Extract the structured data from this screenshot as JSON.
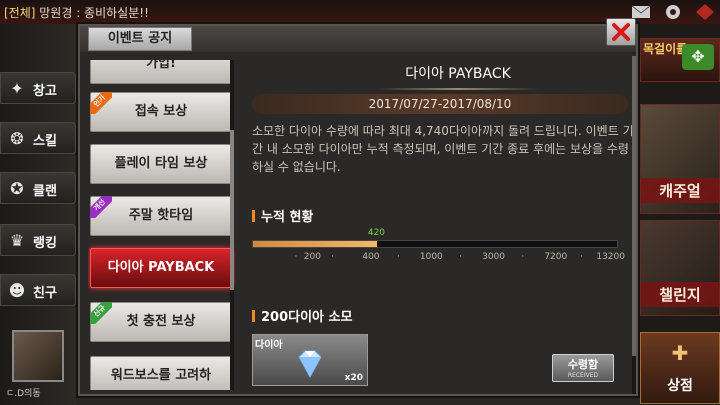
{
  "background": {
    "notice_tag": "[전체]",
    "notice_text": " 망원경 : 종비하실분!!",
    "sidebar": [
      {
        "label": "창고",
        "icon": "gun-icon"
      },
      {
        "label": "스킬",
        "icon": "skill-icon"
      },
      {
        "label": "클랜",
        "icon": "clan-icon"
      },
      {
        "label": "랭킹",
        "icon": "trophy-icon"
      },
      {
        "label": "친구",
        "icon": "friends-icon"
      }
    ],
    "avatar_sub": "ㄷ.D의동",
    "right_panel": {
      "banner1": "목걸이를",
      "casual": "캐주얼",
      "challenge": "챌린지",
      "shop": "상점"
    }
  },
  "modal": {
    "tab_label": "이벤트 공지",
    "menu": [
      {
        "label": "가입!",
        "badge": "",
        "active": false
      },
      {
        "label": "접속 보상",
        "badge": "인기",
        "badge_color": "#ea6a14",
        "active": false
      },
      {
        "label": "플레이 타임 보상",
        "badge": "",
        "active": false
      },
      {
        "label": "주말 핫타임",
        "badge": "개선",
        "badge_color": "#9b2ec2",
        "active": false
      },
      {
        "label": "다이아 PAYBACK",
        "badge": "",
        "active": true
      },
      {
        "label": "첫 충전 보상",
        "badge": "신규",
        "badge_color": "#3aa040",
        "active": false
      },
      {
        "label": "워드보스를 고려하",
        "badge": "",
        "active": false
      }
    ],
    "detail": {
      "title": "다이아 PAYBACK",
      "date_range": "2017/07/27-2017/08/10",
      "description": "소모한 다이아 수량에 따라 최대 4,740다이아까지 돌려 드립니다. 이벤트 기간 내 소모한 다이아만 누적 측정되며, 이벤트 기간 종료 후에는 보상을 수령하실 수 없습니다.",
      "progress_section": "누적 현황",
      "progress_value": 420,
      "progress_value_label": "420",
      "progress_fraction": 0.34,
      "ticks": [
        "200",
        "400",
        "1000",
        "3000",
        "7200",
        "13200"
      ],
      "reward_section": "200다이아 소모",
      "reward_name": "다이아",
      "reward_qty": "x20",
      "receive_label": "수령함",
      "receive_sub": "RECEIVED"
    }
  },
  "colors": {
    "active_red": "#d8242a",
    "progress": "#f4b868",
    "accent": "#f08a20",
    "value_green": "#7fd04a"
  }
}
